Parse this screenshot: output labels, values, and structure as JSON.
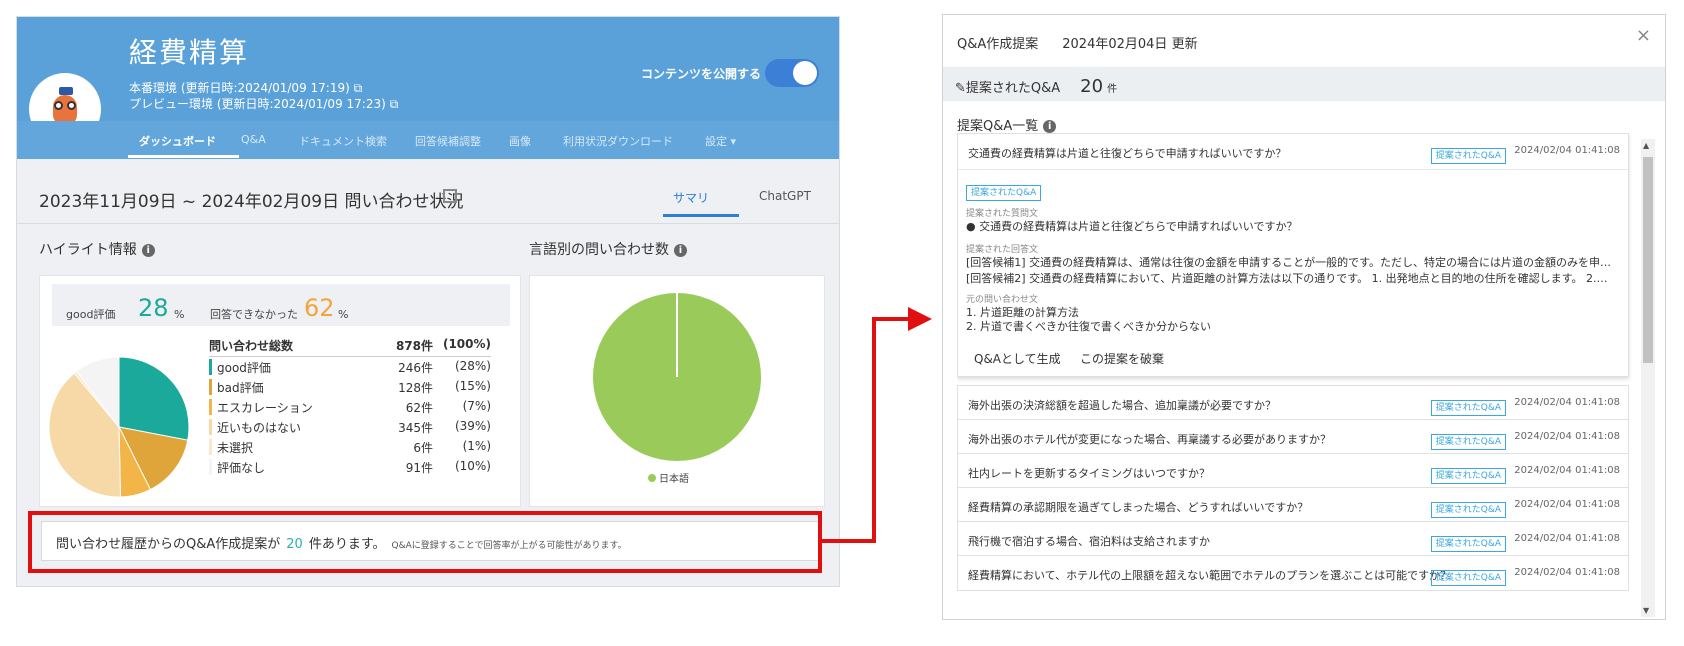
{
  "dashboard": {
    "title": "経費精算",
    "env_prod": "本番環境 (更新日時:2024/01/09 17:19)",
    "env_preview": "プレビュー環境 (更新日時:2024/01/09 17:23)",
    "publish_label": "コンテンツを公開する",
    "nav": [
      "ダッシュボード",
      "Q&A",
      "ドキュメント検索",
      "回答候補調整",
      "画像",
      "利用状況ダウンロード",
      "設定"
    ],
    "period": "2023年11月09日 ~ 2024年02月09日 問い合わせ状況",
    "tabs": [
      "サマリ",
      "ChatGPT"
    ],
    "highlight_title": "ハイライト情報",
    "good_label": "good評価",
    "good_value": "28",
    "unanswered_label": "回答できなかった",
    "unanswered_value": "62",
    "pct_unit": "%",
    "stats_header": {
      "label": "問い合わせ総数",
      "count": "878件",
      "pct": "(100%)"
    },
    "stats": [
      {
        "label": "good評価",
        "count": "246件",
        "pct": "(28%)",
        "color": "#1aa99a",
        "value": 246
      },
      {
        "label": "bad評価",
        "count": "128件",
        "pct": "(15%)",
        "color": "#e0a53a",
        "value": 128
      },
      {
        "label": "エスカレーション",
        "count": "62件",
        "pct": "(7%)",
        "color": "#f3b547",
        "value": 62
      },
      {
        "label": "近いものはない",
        "count": "345件",
        "pct": "(39%)",
        "color": "#f7d9a8",
        "value": 345
      },
      {
        "label": "未選択",
        "count": "6件",
        "pct": "(1%)",
        "color": "#fbe7c9",
        "value": 6
      },
      {
        "label": "評価なし",
        "count": "91件",
        "pct": "(10%)",
        "color": "#f4f4f4",
        "value": 91
      }
    ],
    "lang_title": "言語別の問い合わせ数",
    "lang_legend": "日本語",
    "suggest_pre": "問い合わせ履歴からのQ&A作成提案が",
    "suggest_num": "20",
    "suggest_post": "件あります。",
    "suggest_small": "Q&Aに登録することで回答率が上がる可能性があります。"
  },
  "dialog": {
    "title": "Q&A作成提案",
    "updated": "2024年02月04日 更新",
    "close": "×",
    "band_label": "提案されたQ&A",
    "band_count": "20",
    "band_unit": "件",
    "list_title": "提案Q&A一覧",
    "badge": "提案されたQ&A",
    "expanded": {
      "question": "交通費の経費精算は片道と往復どちらで申請すればいいですか？",
      "date": "2024/02/04 01:41:08",
      "lbl_q": "提案された質問文",
      "q_text": "交通費の経費精算は片道と往復どちらで申請すればいいですか？",
      "lbl_a": "提案された回答文",
      "a1": "[回答候補1] 交通費の経費精算は、通常は往復の金額を申請することが一般的です。ただし、特定の場合には片道の金額のみを申…",
      "a2": "[回答候補2] 交通費の経費精算において、片道距離の計算方法は以下の通りです。 1. 出発地点と目的地の住所を確認します。 2.…",
      "lbl_orig": "元の問い合わせ文",
      "orig1": "1. 片道距離の計算方法",
      "orig2": "2. 片道で書くべきか往復で書くべきか分からない",
      "action_create": "Q&Aとして生成",
      "action_discard": "この提案を破棄"
    },
    "rows": [
      {
        "q": "海外出張の決済総額を超過した場合、追加稟議が必要ですか？",
        "date": "2024/02/04 01:41:08"
      },
      {
        "q": "海外出張のホテル代が変更になった場合、再稟議する必要がありますか？",
        "date": "2024/02/04 01:41:08"
      },
      {
        "q": "社内レートを更新するタイミングはいつですか？",
        "date": "2024/02/04 01:41:08"
      },
      {
        "q": "経費精算の承認期限を過ぎてしまった場合、どうすればいいですか？",
        "date": "2024/02/04 01:41:08"
      },
      {
        "q": "飛行機で宿泊する場合、宿泊料は支給されますか",
        "date": "2024/02/04 01:41:08"
      },
      {
        "q": "経費精算において、ホテル代の上限額を超えない範囲でホテルのプランを選ぶことは可能ですか？",
        "date": "2024/02/04 01:41:08"
      }
    ]
  },
  "colors": {
    "header": "#5aa1d9",
    "teal": "#1aa99a",
    "orange": "#f3a53b",
    "green": "#9acb5a",
    "badge": "#3aa7df",
    "highlight": "#e01010"
  }
}
